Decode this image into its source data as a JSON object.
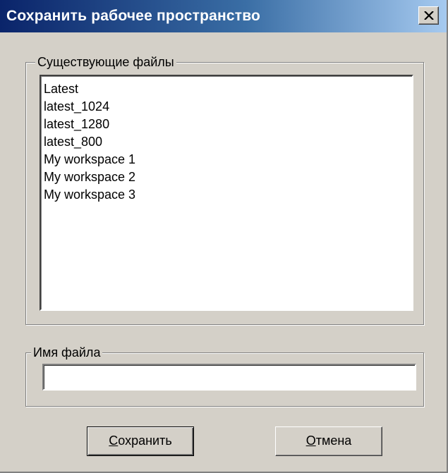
{
  "window": {
    "title": "Сохранить рабочее пространство",
    "close_icon": "close-x-icon"
  },
  "existing_files": {
    "legend": "Существующие файлы",
    "items": [
      "Latest",
      "latest_1024",
      "latest_1280",
      "latest_800",
      "My workspace 1",
      "My workspace 2",
      "My workspace 3"
    ]
  },
  "file_name": {
    "legend": "Имя файла",
    "value": ""
  },
  "buttons": {
    "save": {
      "accel": "С",
      "rest": "охранить"
    },
    "cancel": {
      "accel": "О",
      "rest": "тмена"
    }
  },
  "colors": {
    "title_gradient_start": "#0a246a",
    "title_gradient_end": "#a6caf0",
    "dialog_face": "#d4d0c8"
  }
}
